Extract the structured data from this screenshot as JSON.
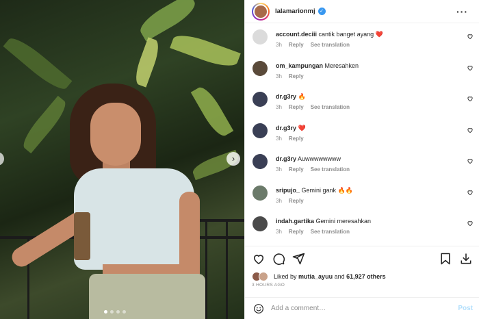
{
  "post": {
    "username": "lalamarionmj",
    "more_icon": "more-horizontal-icon",
    "media_dots": 4,
    "media_active_dot": 1
  },
  "comments": [
    {
      "user": "account.deciii",
      "text": "cantik banget ayang",
      "emoji": "❤️",
      "time": "3h",
      "reply": "Reply",
      "translate": "See translation",
      "avatar_color": "#dbdbdb"
    },
    {
      "user": "om_kampungan",
      "text": "Meresahken",
      "emoji": "",
      "time": "3h",
      "reply": "Reply",
      "translate": "",
      "avatar_color": "#5a4a3a"
    },
    {
      "user": "dr.g3ry",
      "text": "",
      "emoji": "🔥",
      "time": "3h",
      "reply": "Reply",
      "translate": "See translation",
      "avatar_color": "#3a3f55"
    },
    {
      "user": "dr.g3ry",
      "text": "",
      "emoji": "❤️",
      "time": "3h",
      "reply": "Reply",
      "translate": "",
      "avatar_color": "#3a3f55"
    },
    {
      "user": "dr.g3ry",
      "text": "Auwwwwwwww",
      "emoji": "",
      "time": "3h",
      "reply": "Reply",
      "translate": "See translation",
      "avatar_color": "#3a3f55"
    },
    {
      "user": "sripujo_",
      "text": "Gemini gank",
      "emoji": "🔥🔥",
      "time": "3h",
      "reply": "Reply",
      "translate": "",
      "avatar_color": "#6b7a6a"
    },
    {
      "user": "indah.gartika",
      "text": "Gemini meresahkan",
      "emoji": "",
      "time": "3h",
      "reply": "Reply",
      "translate": "See translation",
      "avatar_color": "#4a4a4a"
    }
  ],
  "likes": {
    "prefix": "Liked by",
    "user": "mutia_ayuu",
    "middle": "and",
    "count": "61,927 others"
  },
  "time_ago": "3 HOURS AGO",
  "add_comment": {
    "placeholder": "Add a comment…",
    "post_label": "Post"
  },
  "colors": {
    "accent": "#3897f0",
    "heart": "#ed4956",
    "muted": "#8e8e8e",
    "post_disabled": "#b2dffc"
  }
}
